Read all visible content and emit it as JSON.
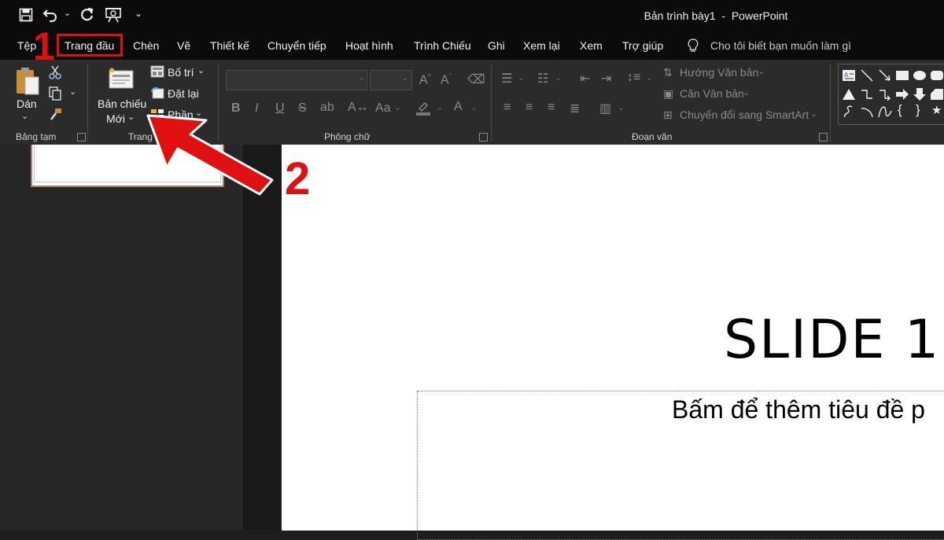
{
  "window": {
    "title": "Bản trình bày1  -  PowerPoint"
  },
  "quick_access": [
    {
      "name": "save-icon"
    },
    {
      "name": "undo-icon"
    },
    {
      "name": "redo-icon"
    },
    {
      "name": "present-icon"
    },
    {
      "name": "customize-icon"
    }
  ],
  "menu": {
    "items": [
      "Tệp",
      "Trang đầu",
      "Chèn",
      "Vẽ",
      "Thiết kế",
      "Chuyển tiếp",
      "Hoạt hình",
      "Trình Chiếu",
      "Ghi",
      "Xem lại",
      "Xem",
      "Trợ giúp"
    ],
    "tell_me": "Cho tôi biết bạn muốn làm gì"
  },
  "ribbon": {
    "clipboard": {
      "paste": "Dán",
      "label": "Bảng tạm"
    },
    "slides": {
      "new_slide_line1": "Bản chiếu",
      "new_slide_line2": "Mới",
      "layout": "Bố trí",
      "reset": "Đặt lại",
      "section": "Phần",
      "label": "Trang"
    },
    "font": {
      "bold": "B",
      "italic": "I",
      "underline": "U",
      "strike": "S",
      "aa": "Aa",
      "label": "Phông chữ"
    },
    "paragraph": {
      "text_direction": "Hướng Văn bản",
      "align_text": "Căn Văn bản",
      "smartart": "Chuyển đổi sang SmartArt",
      "label": "Đoạn văn"
    },
    "drawing": {
      "shape_icons": [
        "text-box-icon",
        "line-icon",
        "arrow-line-icon",
        "rectangle-icon",
        "oval-icon",
        "rounded-rect-icon",
        "triangle-icon",
        "elbow-connector-icon",
        "elbow-arrow-icon",
        "right-arrow-icon",
        "down-arrow-icon",
        "shape-icon",
        "freeform-icon",
        "arc-icon",
        "curve-icon",
        "left-brace-icon",
        "right-brace-icon",
        "star-icon"
      ]
    }
  },
  "slide": {
    "title": "SLIDE 1",
    "subtitle_placeholder": "Bấm để thêm tiêu đề p"
  },
  "annotations": {
    "step1": "1",
    "step2": "2",
    "color": "#e01010"
  },
  "colors": {
    "titlebar": "#0b0b0b",
    "ribbon": "#2b2b2b",
    "slide": "#ffffff"
  }
}
